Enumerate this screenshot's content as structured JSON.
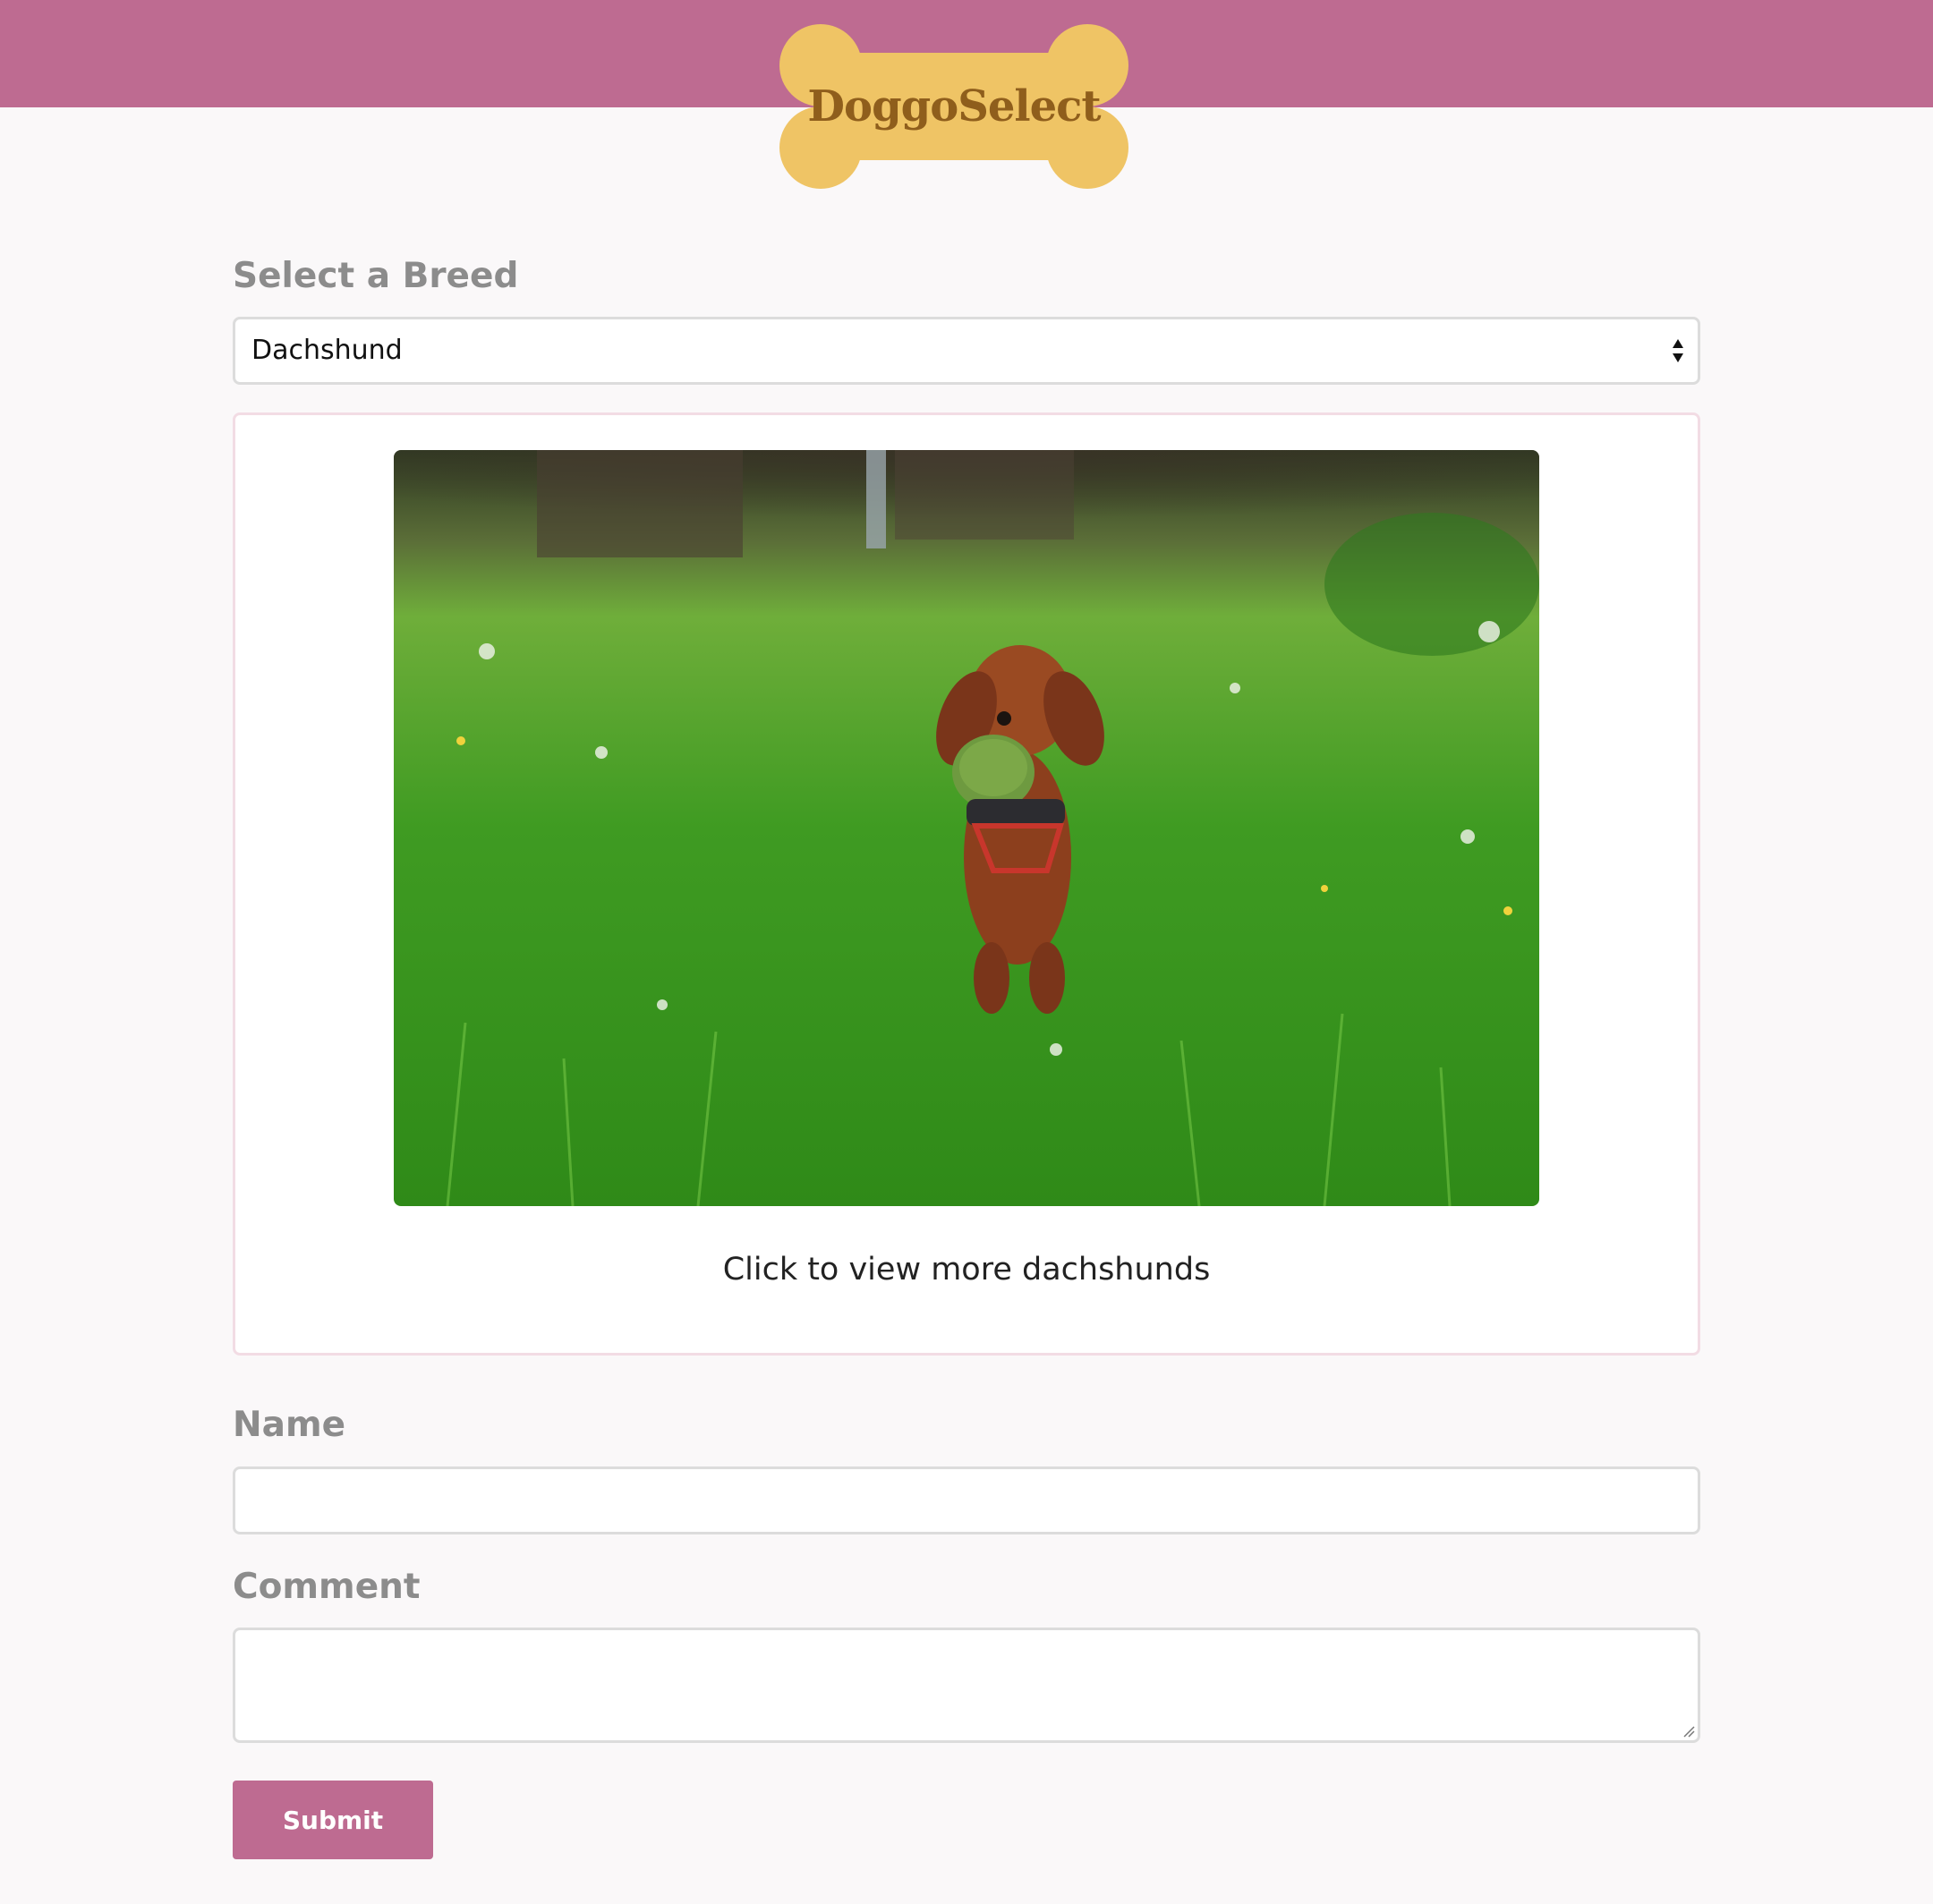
{
  "brand": {
    "name": "DoggoSelect",
    "header_color": "#be6b91",
    "logo_color": "#efc465",
    "logo_text_color": "#8f5e1c"
  },
  "breed_select": {
    "label": "Select a Breed",
    "selected": "Dachshund"
  },
  "image_card": {
    "caption": "Click to view more dachshunds"
  },
  "name_field": {
    "label": "Name",
    "value": ""
  },
  "comment_field": {
    "label": "Comment",
    "value": ""
  },
  "submit": {
    "label": "Submit"
  }
}
